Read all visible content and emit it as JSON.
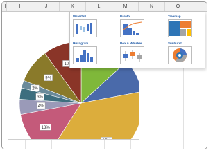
{
  "columns": [
    "H",
    "I",
    "J",
    "K",
    "L",
    "M",
    "N",
    "O"
  ],
  "chart_data": {
    "type": "pie",
    "labels": [
      "37%",
      "13%",
      "4%",
      "3%",
      "2%",
      "9%",
      "10%"
    ],
    "values": [
      37,
      13,
      4,
      3,
      2,
      9,
      10
    ],
    "colors": [
      "#dcad3c",
      "#c45a7a",
      "#9a9ab8",
      "#3d6e7e",
      "#6a8a9a",
      "#8a7a2a",
      "#8a3528"
    ],
    "hidden_region_colors": [
      "#7fb83a",
      "#4a6aaa"
    ]
  },
  "chart_gallery": {
    "items": [
      {
        "label": "Waterfall",
        "icon": "waterfall-chart-icon"
      },
      {
        "label": "Pareto",
        "icon": "pareto-chart-icon"
      },
      {
        "label": "Treemap",
        "icon": "treemap-chart-icon"
      },
      {
        "label": "Histogram",
        "icon": "histogram-chart-icon"
      },
      {
        "label": "Box & Whisker",
        "icon": "box-whisker-chart-icon"
      },
      {
        "label": "Sunburst",
        "icon": "sunburst-chart-icon"
      }
    ]
  }
}
